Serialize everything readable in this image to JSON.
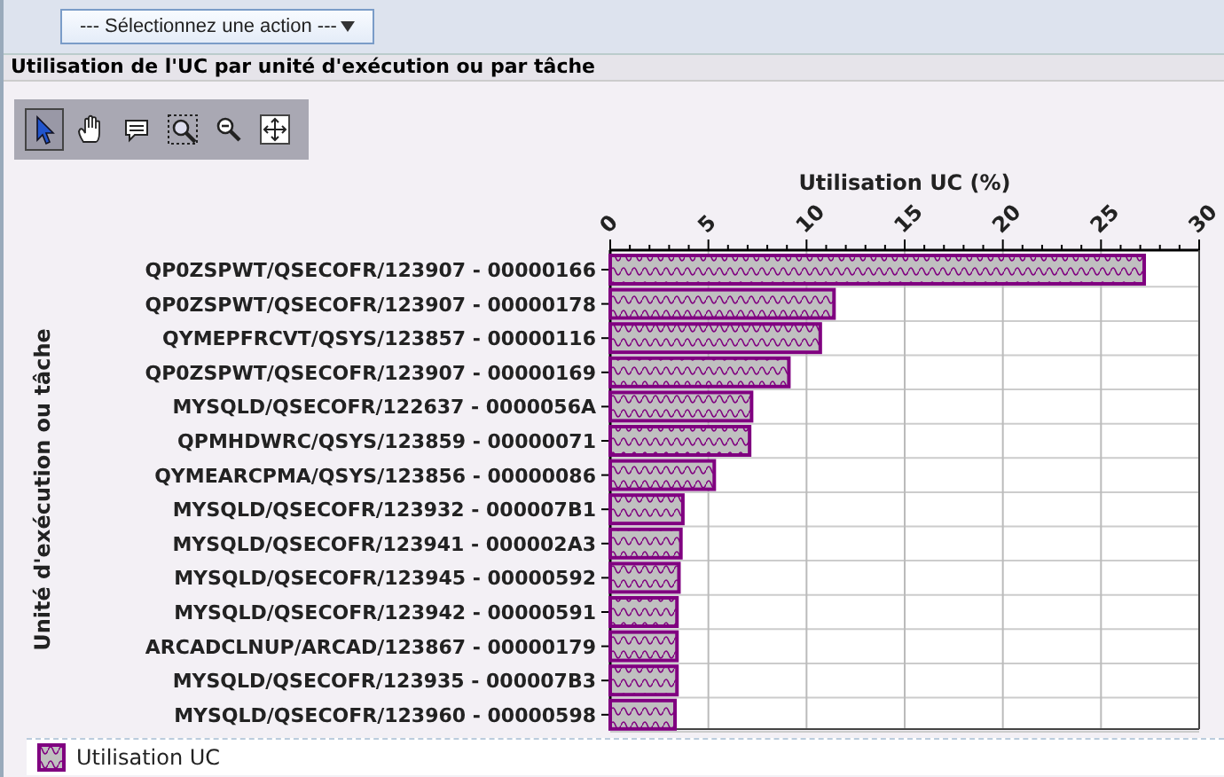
{
  "action_menu": {
    "label": "--- Sélectionnez une action ---"
  },
  "panel_title": "Utilisation de l'UC par unité d'exécution ou par tâche",
  "tools": [
    {
      "kind": "pointer",
      "selected": true
    },
    {
      "kind": "hand",
      "selected": false
    },
    {
      "kind": "comment",
      "selected": false
    },
    {
      "kind": "zoom-box",
      "selected": false
    },
    {
      "kind": "zoom-out",
      "selected": false
    },
    {
      "kind": "fit",
      "selected": false
    }
  ],
  "chart_data": {
    "type": "bar",
    "orientation": "horizontal",
    "xlabel": "Utilisation UC (%)",
    "ylabel": "Unité d'exécution ou tâche",
    "xlim": [
      0,
      30
    ],
    "xticks": [
      0,
      5,
      10,
      15,
      20,
      25,
      30
    ],
    "grid": true,
    "categories": [
      "QP0ZSPWT/QSECOFR/123907 - 00000166",
      "QP0ZSPWT/QSECOFR/123907 - 00000178",
      "QYMEPFRCVT/QSYS/123857 - 00000116",
      "QP0ZSPWT/QSECOFR/123907 - 00000169",
      "MYSQLD/QSECOFR/122637 - 0000056A",
      "QPMHDWRC/QSYS/123859 - 00000071",
      "QYMEARCPMA/QSYS/123856 - 00000086",
      "MYSQLD/QSECOFR/123932 - 000007B1",
      "MYSQLD/QSECOFR/123941 - 000002A3",
      "MYSQLD/QSECOFR/123945 - 00000592",
      "MYSQLD/QSECOFR/123942 - 00000591",
      "ARCADCLNUP/ARCAD/123867 - 00000179",
      "MYSQLD/QSECOFR/123935 - 000007B3",
      "MYSQLD/QSECOFR/123960 - 00000598"
    ],
    "series": [
      {
        "name": "Utilisation UC",
        "color": "#800080",
        "values": [
          27.2,
          11.4,
          10.7,
          9.1,
          7.2,
          7.1,
          5.3,
          3.7,
          3.6,
          3.5,
          3.4,
          3.4,
          3.4,
          3.3
        ]
      }
    ]
  }
}
